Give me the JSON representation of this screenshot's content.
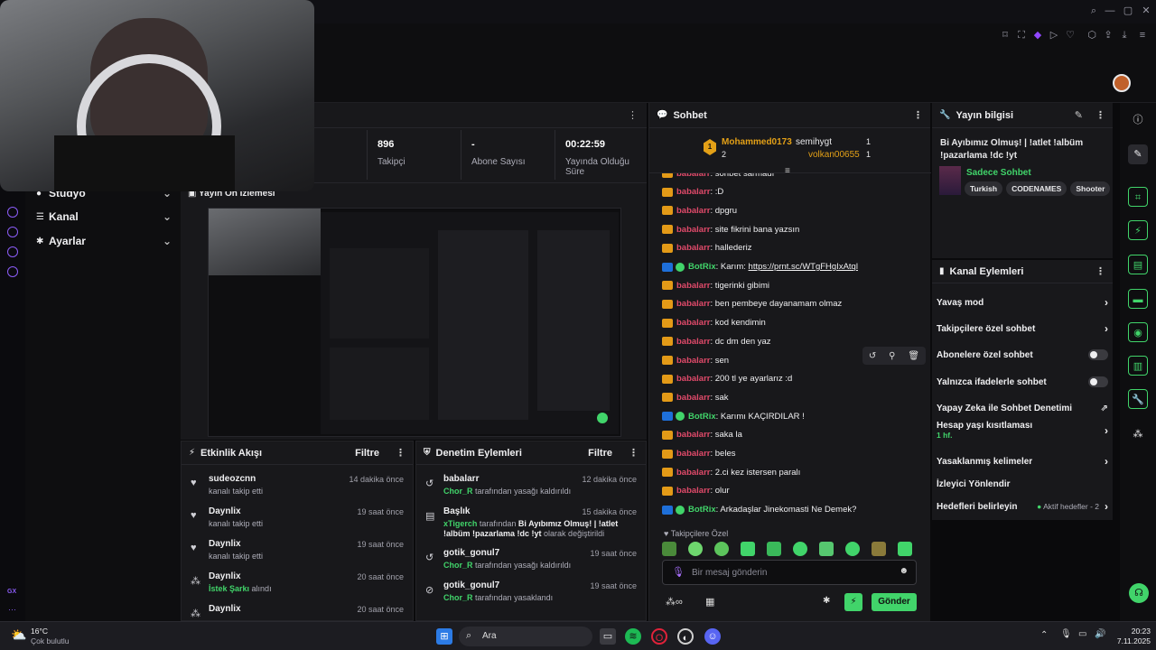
{
  "colors": {
    "accent": "#41d46a",
    "brand": "#9147ff",
    "panel": "#18181b"
  },
  "stats": [
    {
      "value": "896",
      "label": "Takipçi"
    },
    {
      "value": "-",
      "label": "Abone Sayısı"
    },
    {
      "value": "00:22:59",
      "label": "Yayında Olduğu Süre"
    }
  ],
  "nav": {
    "items": [
      {
        "label": "Stüdyo",
        "icon": "camera-icon"
      },
      {
        "label": "Kanal",
        "icon": "list-icon"
      },
      {
        "label": "Ayarlar",
        "icon": "gear-icon"
      }
    ]
  },
  "preview": {
    "title": "Yayın Ön İzlemesi"
  },
  "activity": {
    "title": "Etkinlik Akışı",
    "filter": "Filtre",
    "items": [
      {
        "name": "sudeozcnn",
        "sub": "kanalı takip etti",
        "time": "14 dakika önce"
      },
      {
        "name": "Daynlix",
        "sub": "kanalı takip etti",
        "time": "19 saat önce"
      },
      {
        "name": "Daynlix",
        "sub": "kanalı takip etti",
        "time": "19 saat önce"
      },
      {
        "name": "Daynlix",
        "sub_green": "İstek Şarkı",
        "sub": "alındı",
        "time": "20 saat önce"
      },
      {
        "name": "Daynlix",
        "sub": "",
        "time": "20 saat önce"
      }
    ]
  },
  "moderation": {
    "title": "Denetim Eylemleri",
    "filter": "Filtre",
    "items": [
      {
        "name": "babalarr",
        "actor": "Chor_R",
        "sub": "tarafından yasağı kaldırıldı",
        "time": "12 dakika önce"
      },
      {
        "name": "Başlık",
        "actor": "xTigerch",
        "sub": "tarafından",
        "bold": "Bi Ayıbımız Olmuş! | !atlet !albüm !pazarlama !dc !yt",
        "sub2": "olarak değiştirildi",
        "time": "15 dakika önce"
      },
      {
        "name": "gotik_gonul7",
        "actor": "Chor_R",
        "sub": "tarafından yasağı kaldırıldı",
        "time": "19 saat önce"
      },
      {
        "name": "gotik_gonul7",
        "actor": "Chor_R",
        "sub": "tarafından yasaklandı",
        "time": "19 saat önce"
      }
    ]
  },
  "chat": {
    "title": "Sohbet",
    "pinned": [
      {
        "rank": "1",
        "user": "Mohammed0173",
        "count": "2"
      },
      {
        "user": "semihygt",
        "count": "1"
      },
      {
        "user": "volkan00655",
        "count": "1"
      }
    ],
    "messages": [
      {
        "user": "babalarr",
        "text": ": sohbet sarmadı"
      },
      {
        "user": "babalarr",
        "text": ": :D"
      },
      {
        "user": "babalarr",
        "text": ": dpgru"
      },
      {
        "user": "babalarr",
        "text": ": site fikrini bana yazsın"
      },
      {
        "user": "babalarr",
        "text": ": hallederiz"
      },
      {
        "user": "BotRix",
        "bot": true,
        "text": ": Karım: ",
        "link": "https://prnt.sc/WTgFHgIxAtql"
      },
      {
        "user": "babalarr",
        "text": ": tigerinki gibimi"
      },
      {
        "user": "babalarr",
        "text": ": ben pembeye dayanamam olmaz"
      },
      {
        "user": "babalarr",
        "text": ": kod kendimin"
      },
      {
        "user": "babalarr",
        "text": ": dc dm den yaz"
      },
      {
        "user": "babalarr",
        "text": ": sen"
      },
      {
        "user": "babalarr",
        "text": ": 200 tl ye ayarlarız :d"
      },
      {
        "user": "babalarr",
        "text": ": sak"
      },
      {
        "user": "BotRix",
        "bot": true,
        "text": ": Karımı KAÇIRDILAR !"
      },
      {
        "user": "babalarr",
        "text": ": saka la"
      },
      {
        "user": "babalarr",
        "text": ": beles"
      },
      {
        "user": "babalarr",
        "text": ": 2.ci kez istersen paralı"
      },
      {
        "user": "babalarr",
        "text": ": olur"
      },
      {
        "user": "BotRix",
        "bot": true,
        "text": ": Arkadaşlar Jinekomasti Ne Demek?"
      }
    ],
    "emote_label": "Takipçilere Özel",
    "input_placeholder": "Bir mesaj gönderin",
    "send": "Gönder"
  },
  "info": {
    "title": "Yayın bilgisi",
    "stream_title": "Bi Ayıbımız Olmuş! | !atlet !albüm !pazarlama !dc !yt",
    "category": "Sadece Sohbet",
    "tags": [
      "Turkish",
      "CODENAMES",
      "Shooter"
    ]
  },
  "actions": {
    "title": "Kanal Eylemleri",
    "items": [
      {
        "label": "Yavaş mod",
        "type": "chevron"
      },
      {
        "label": "Takipçilere özel sohbet",
        "type": "chevron"
      },
      {
        "label": "Abonelere özel sohbet",
        "type": "toggle"
      },
      {
        "label": "Yalnızca ifadelerle sohbet",
        "type": "toggle"
      },
      {
        "label": "Yapay Zeka ile Sohbet Denetimi",
        "type": "external"
      },
      {
        "label": "Hesap yaşı kısıtlaması",
        "sub": "1 hf.",
        "type": "chevron"
      },
      {
        "label": "Yasaklanmış kelimeler",
        "type": "chevron"
      },
      {
        "label": "İzleyici Yönlendir",
        "type": "none"
      },
      {
        "label": "Hedefleri belirleyin",
        "extra": "Aktif hedefler - 2",
        "type": "chevron"
      }
    ]
  },
  "taskbar": {
    "weather_temp": "16°C",
    "weather_desc": "Çok bulutlu",
    "search": "Ara",
    "time": "20:23",
    "date": "7.11.2025"
  },
  "rail": {
    "gx": "GX"
  }
}
